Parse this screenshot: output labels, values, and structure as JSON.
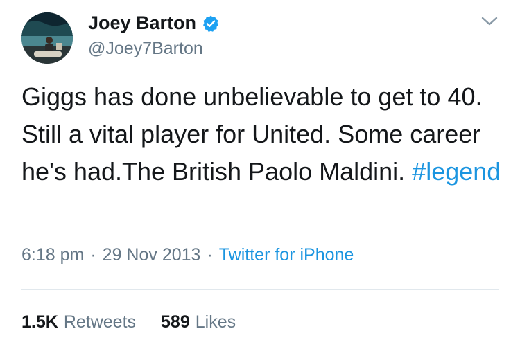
{
  "tweet": {
    "author": {
      "name": "Joey Barton",
      "handle": "@Joey7Barton",
      "verified": true
    },
    "text_main": "Giggs has done unbelievable to get to 40. Still a vital player for United. Some career he's had.The British Paolo Maldini. ",
    "hashtag": "#legend",
    "time": "6:18 pm",
    "separator": "·",
    "date": "29 Nov 2013",
    "source": "Twitter for iPhone",
    "retweets": {
      "count": "1.5K",
      "label": "Retweets"
    },
    "likes": {
      "count": "589",
      "label": "Likes"
    }
  },
  "colors": {
    "link": "#1b95e0",
    "muted": "#657786",
    "text": "#14171a",
    "divider": "#e1e8ed"
  },
  "icons": {
    "verified": "verified-badge-icon",
    "menu": "chevron-down-icon"
  }
}
